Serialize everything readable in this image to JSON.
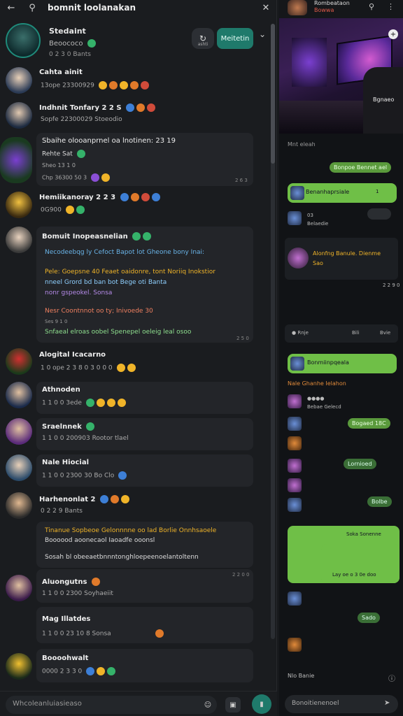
{
  "left": {
    "topbar": {
      "back_icon": "arrow-left-icon",
      "title": "bomnit loolanakan",
      "close_icon": "close-icon"
    },
    "profile": {
      "name": "Stedaint",
      "sub": "Beoococo",
      "stat": "0 2 3 0 Bants",
      "share_label": "ashti",
      "follow_label": "Meitetin"
    },
    "items": [
      {
        "name": "Cahta ainit",
        "sub": "13ope 23300929",
        "time": ""
      },
      {
        "name": "Indhnit Tonfary  2 2 S",
        "sub": "Sopfe 22300029  Stoeodio",
        "time": ""
      },
      {
        "name": "Sbaihe olooanprnel oa lnotinen:  23 19",
        "sub": "Rehte Sat",
        "sub2": "Sheo 13 1 0",
        "sub3": "Chp 36300 50 3",
        "time": "2 6 3"
      },
      {
        "name": "Hemiikanoray  2 2 3",
        "sub": "0G900",
        "time": ""
      },
      {
        "name": "Bomuit Inopeasnelian",
        "lines": [
          "Necodeebqg ly Cefoct Bapot lot Gheone bony Inai:",
          "Pele: Goepsne 40 Feaet oaidonre, tont Noriiq Inokstior",
          "nneel Grord bd ban bot Bege oti Banta",
          "nonr gspeokel. Sonsa",
          "Nesr Coontnnot oo ty; Inivoede 30",
          "Ses 9 1 0",
          "Snfaeal elroas oobel Spenepel oeleig leal osoo"
        ],
        "time": "2 5 0"
      },
      {
        "name": "Alogital Icacarno",
        "sub": "1 0 ope 2 3 8 0 3 0 0 0",
        "time": ""
      },
      {
        "name": "Athnoden",
        "sub": "1 1 0 0 3ede",
        "time": ""
      },
      {
        "name": "Sraelnnek",
        "sub": "1 1 0 0 200903  Rootor tlael",
        "time": ""
      },
      {
        "name": "Nale Hiocial",
        "sub": "1 1 0 0 2300 30   Bo Clo",
        "time": ""
      },
      {
        "name": "Harhenonlat  2",
        "sub": "0 2 2 9 Bants",
        "lines": [
          "Tinanue  Sopbeoe Gelonnnne oo lad Borlie Onnhsaoele",
          "Boooood aoonecaol  Iaoadfe ooonsl",
          "Sosah bl obeeaetbnnntonghloepeenoelantoltenn"
        ],
        "time": "2 2 0 0"
      },
      {
        "name": "Aluongutns",
        "sub": "1 1 0 0 2300  Soyhaeiit",
        "time": ""
      },
      {
        "name": "Mag Illatdes",
        "sub": "1 1 0 0 23 10  8 Sonsa",
        "time": ""
      },
      {
        "name": "Boooohwalt",
        "sub": "0000 2 3 3 0",
        "time": ""
      }
    ],
    "composer": {
      "placeholder": "Whcoleanluiasieaso"
    }
  },
  "right": {
    "header": {
      "title": "Rombeataon",
      "sub": "Bowwa"
    },
    "hero": {
      "label": "Bgnaeo"
    },
    "labels": {
      "caption1": "Mnt eleah",
      "msg_out1": "Bonpoe Bennet ael",
      "msg_card1": "Benanhaprsiale",
      "msg_card1_side": "1",
      "mini1": "03",
      "mini1b": "Belaedie",
      "feature_title": "Alonfng Banule. Dienme",
      "feature_sub": "Sao",
      "time1": "2 2 9 0",
      "poll_a": "Rnje",
      "poll_b": "Bili",
      "poll_c": "Bvie",
      "msg_card2": "Bonmiinpqeala",
      "section": "Nale Ghanhe Ielahon",
      "row1": "Bebae Gelecd",
      "bubble_a": "Bogaed 18C",
      "bubble_b": "Lornioed",
      "bubble_c": "Bolbe",
      "big_bubble_top": "Soka Sonenne",
      "big_bubble_bottom": "Lay oe o 3 0e doo",
      "bubble_d": "Sado",
      "footer_label": "Nlo Banie",
      "composer": "Bonoitienenoel"
    }
  }
}
